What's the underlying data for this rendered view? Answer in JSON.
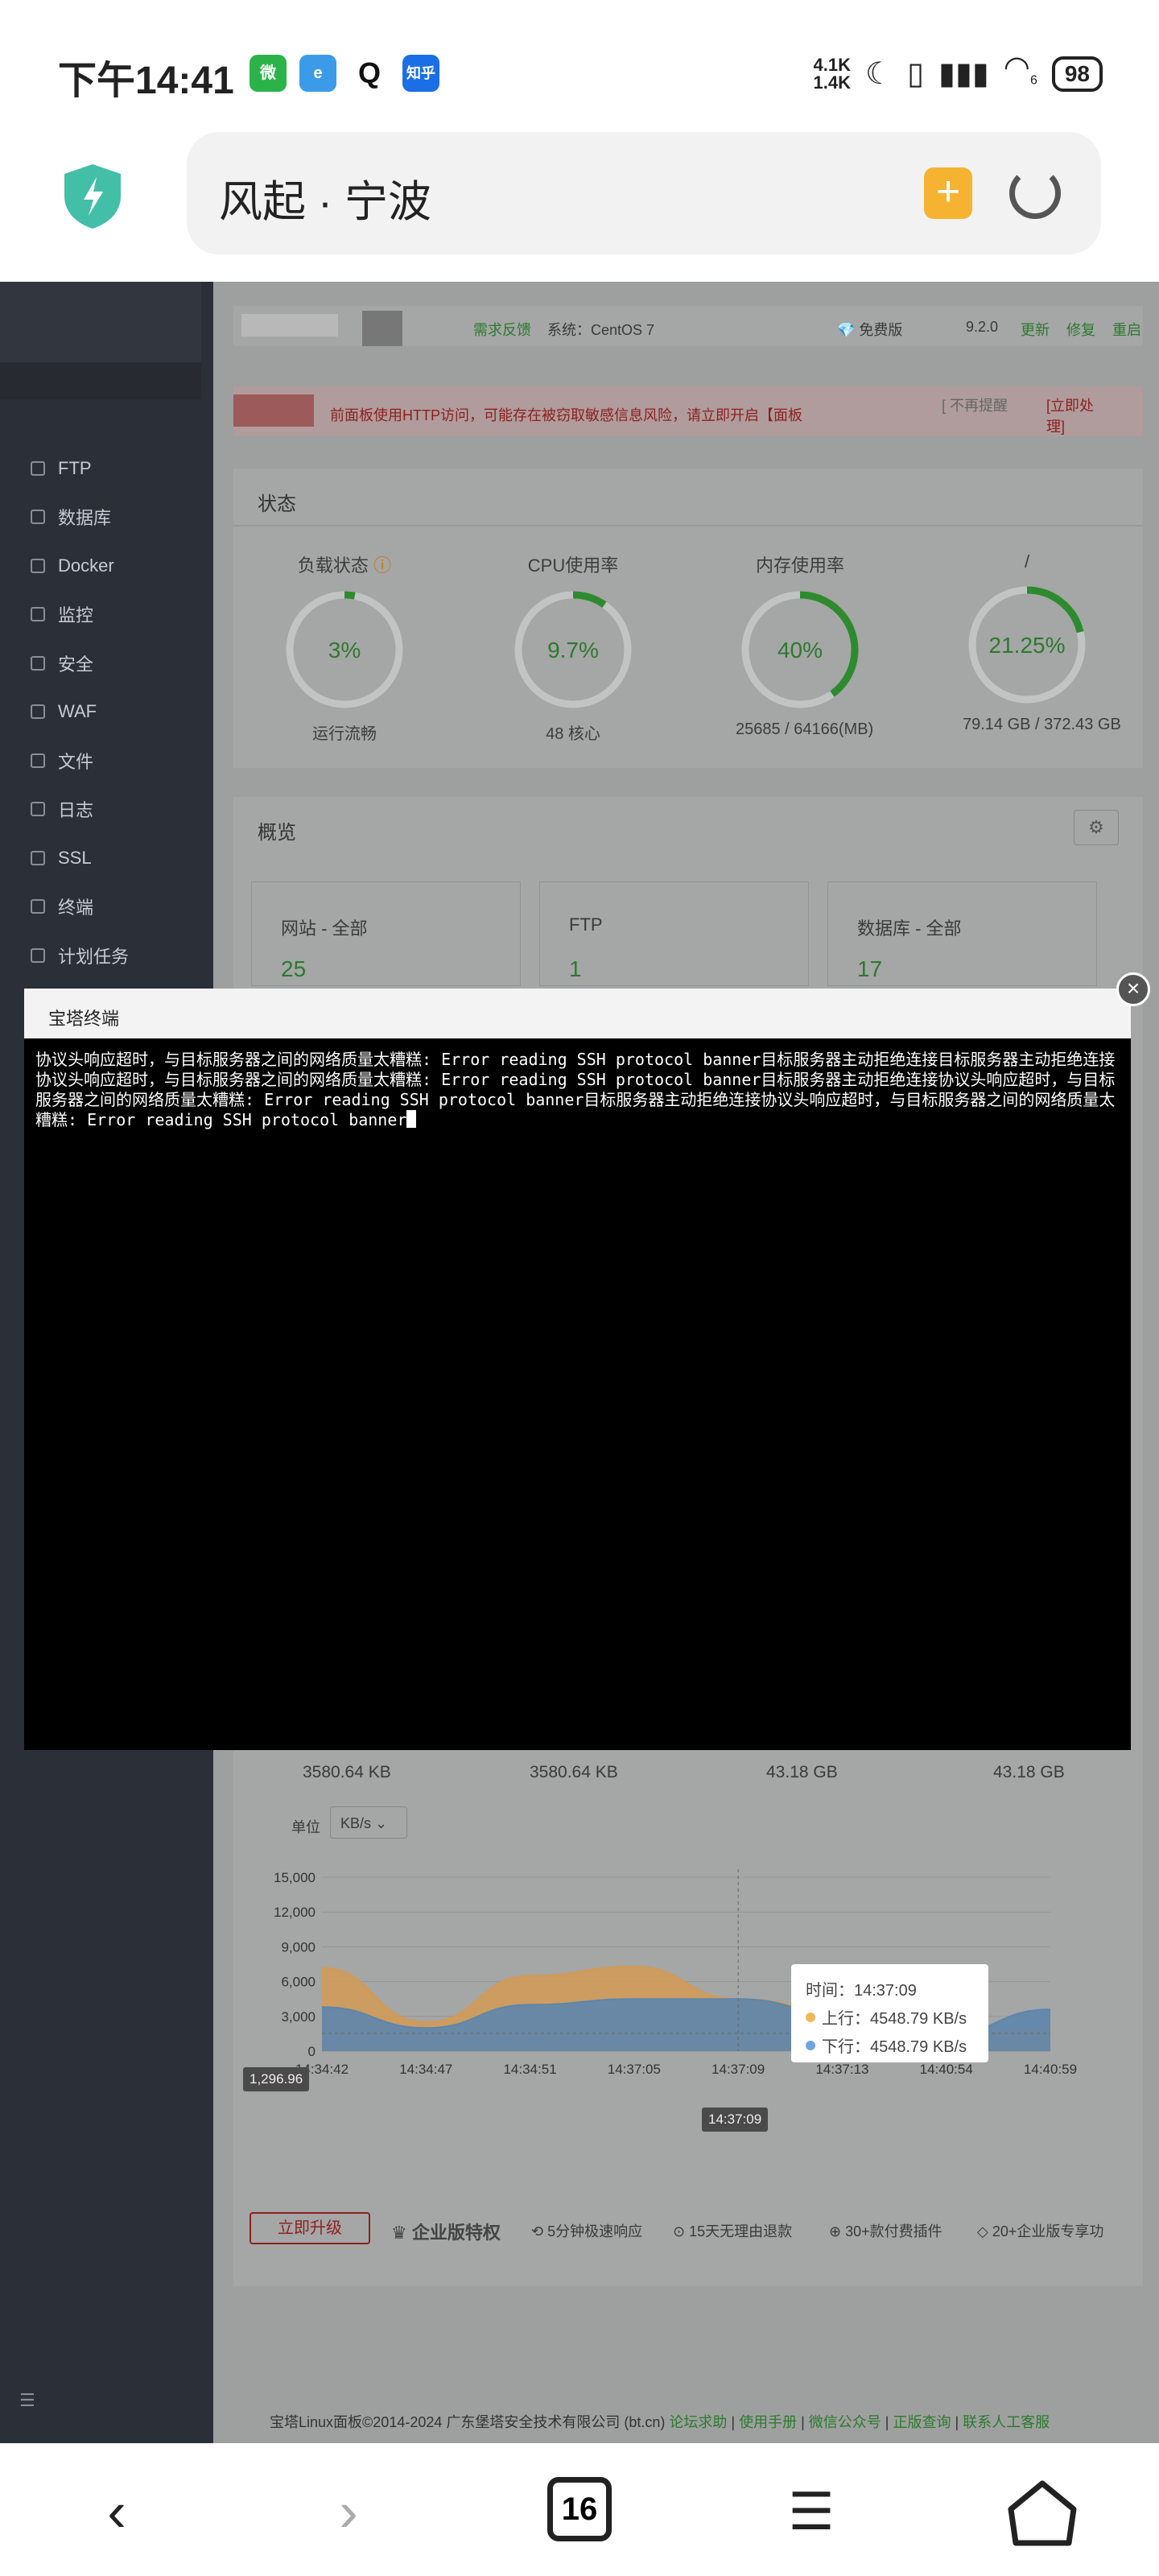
{
  "status_bar": {
    "time": "下午14:41",
    "apps": [
      "微",
      "e",
      "Q",
      "知乎"
    ],
    "net_up": "4.1K",
    "net_down": "1.4K",
    "wifi_sub": "6",
    "battery": "98"
  },
  "address_bar": {
    "title": "风起 · 宁波"
  },
  "sidebar": {
    "items": [
      "FTP",
      "数据库",
      "Docker",
      "监控",
      "安全",
      "WAF",
      "文件",
      "日志",
      "SSL",
      "终端",
      "计划任务"
    ]
  },
  "top_info": {
    "feedback": "需求反馈",
    "system": "系统：CentOS 7",
    "edition": "免费版",
    "version": "9.2.0",
    "update": "更新",
    "repair": "修复",
    "restart": "重启"
  },
  "alert": {
    "text": "前面板使用HTTP访问，可能存在被窃取敏感信息风险，请立即开启【面板",
    "ignore": "[ 不再提醒",
    "handle": "[立即处理]"
  },
  "status": {
    "title": "状态",
    "gauges": [
      {
        "label": "负载状态",
        "value": "3%",
        "sub": "运行流畅",
        "pct": 3
      },
      {
        "label": "CPU使用率",
        "value": "9.7%",
        "sub": "48 核心",
        "pct": 9.7
      },
      {
        "label": "内存使用率",
        "value": "40%",
        "sub": "25685 / 64166(MB)",
        "pct": 40
      },
      {
        "label": "/",
        "value": "21.25%",
        "sub": "79.14 GB / 372.43 GB",
        "pct": 21.25
      }
    ]
  },
  "overview": {
    "title": "概览",
    "cards": [
      {
        "label": "网站 - 全部",
        "value": "25"
      },
      {
        "label": "FTP",
        "value": "1"
      },
      {
        "label": "数据库 - 全部",
        "value": "17"
      }
    ]
  },
  "terminal": {
    "title": "宝塔终端",
    "output": "协议头响应超时，与目标服务器之间的网络质量太糟糕: Error reading SSH protocol banner目标服务器主动拒绝连接目标服务器主动拒绝连接协议头响应超时，与目标服务器之间的网络质量太糟糕: Error reading SSH protocol banner目标服务器主动拒绝连接协议头响应超时，与目标服务器之间的网络质量太糟糕: Error reading SSH protocol banner目标服务器主动拒绝连接协议头响应超时，与目标服务器之间的网络质量太糟糕: Error reading SSH protocol banner"
  },
  "traffic": {
    "stats": [
      "3580.64 KB",
      "3580.64 KB",
      "43.18 GB",
      "43.18 GB"
    ],
    "unit_label": "单位",
    "unit_value": "KB/s",
    "hover_value": "1,296.96",
    "hover_time": "14:37:09"
  },
  "chart_data": {
    "type": "area",
    "x": [
      "14:34:42",
      "14:34:47",
      "14:34:51",
      "14:37:05",
      "14:37:09",
      "14:37:13",
      "14:40:54",
      "14:40:59"
    ],
    "yticks": [
      "15,000",
      "12,000",
      "9,000",
      "6,000",
      "3,000",
      "0"
    ],
    "ylim": [
      0,
      15000
    ],
    "series": [
      {
        "name": "上行",
        "color": "#d29a54",
        "values": [
          7200,
          2500,
          6500,
          7300,
          4500,
          3500,
          1500,
          2000
        ]
      },
      {
        "name": "下行",
        "color": "#5d86ad",
        "values": [
          3800,
          2000,
          4000,
          4500,
          4500,
          3200,
          1500,
          3600
        ]
      }
    ],
    "tooltip": {
      "time": "时间：14:37:09",
      "up": "上行：4548.79 KB/s",
      "down": "下行：4548.79 KB/s"
    }
  },
  "promo": {
    "upgrade": "立即升级",
    "enterprise": "企业版特权",
    "items": [
      "5分钟极速响应",
      "15天无理由退款",
      "30+款付费插件",
      "20+企业版专享功"
    ]
  },
  "footer": {
    "copyright": "宝塔Linux面板©2014-2024 广东堡塔安全技术有限公司 (bt.cn)",
    "links": [
      "论坛求助",
      "使用手册",
      "微信公众号",
      "正版查询",
      "联系人工客服"
    ]
  },
  "bottom_nav": {
    "tabs_count": "16"
  }
}
